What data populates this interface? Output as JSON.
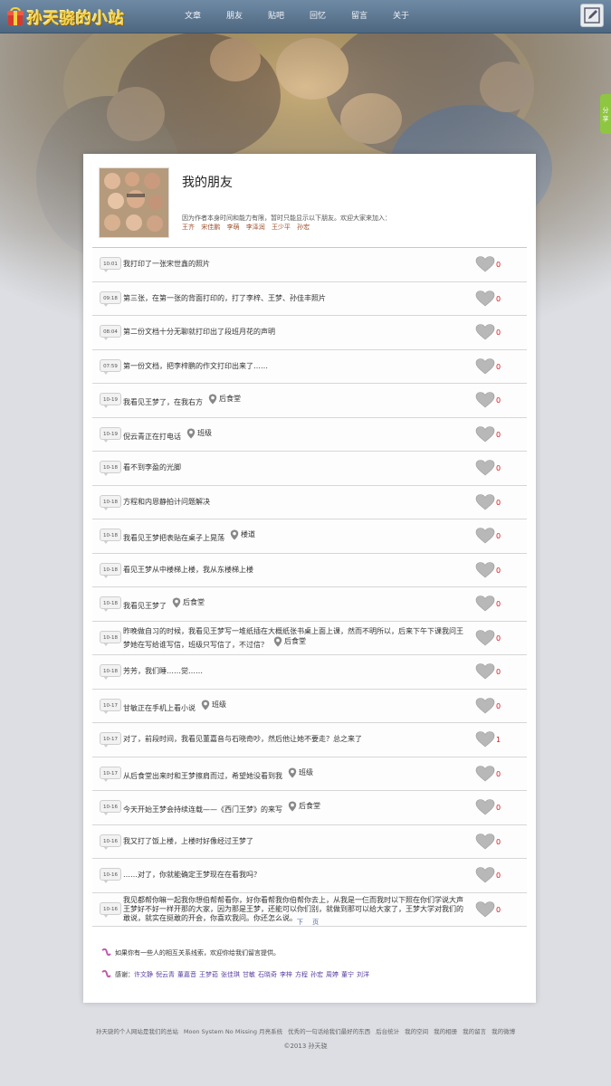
{
  "header": {
    "site_title": "孙天骁的小站",
    "nav": [
      "文章",
      "朋友",
      "贴吧",
      "回忆",
      "留言",
      "关于"
    ]
  },
  "side_tab": "分 享",
  "profile": {
    "title": "我的朋友",
    "description": "因为作者本身时间和能力有限，暂时只能显示以下朋友。欢迎大家来加入：",
    "members": [
      "王齐",
      "宋佳鹏",
      "李萌",
      "李泽润",
      "王少平",
      "孙宏"
    ]
  },
  "messages": [
    {
      "time": "10:01",
      "text": "我打印了一张宋世鑫的照片",
      "location": "",
      "likes": "0"
    },
    {
      "time": "09:18",
      "text": "第三张，在第一张的背面打印的，打了李梓、王梦、孙佳丰照片",
      "location": "",
      "likes": "0"
    },
    {
      "time": "08:04",
      "text": "第二份文档十分无聊就打印出了段班月花的声明",
      "location": "",
      "likes": "0"
    },
    {
      "time": "07:59",
      "text": "第一份文档，把李梓鹏的作文打印出来了……",
      "location": "",
      "likes": "0"
    },
    {
      "time": "10-19",
      "text": "我看见王梦了，在我右方",
      "location": "后食堂",
      "likes": "0"
    },
    {
      "time": "10-19",
      "text": "倪云青正在打电话",
      "location": "班级",
      "likes": "0"
    },
    {
      "time": "10-18",
      "text": "看不到李盈的光脚",
      "location": "",
      "likes": "0"
    },
    {
      "time": "10-18",
      "text": "方程和内恩静拍计问题解决",
      "location": "",
      "likes": "0"
    },
    {
      "time": "10-18",
      "text": "我看见王梦把表贴在桌子上晃荡",
      "location": "楼道",
      "likes": "0"
    },
    {
      "time": "10-18",
      "text": "看见王梦从中楼梯上楼，我从东楼梯上楼",
      "location": "",
      "likes": "0"
    },
    {
      "time": "10-18",
      "text": "我看见王梦了",
      "location": "后食堂",
      "likes": "0"
    },
    {
      "time": "10-18",
      "text": "昨晚做自习的时候，我看见王梦写一堆纸插在大概纸张书桌上面上课，然而不明所以，后来下午下课我问王梦她在写给谁写信，班级只写信了，不过信？",
      "location": "后食堂",
      "likes": "0"
    },
    {
      "time": "10-18",
      "text": "芳芳，我们睡……觉……",
      "location": "",
      "likes": "0"
    },
    {
      "time": "10-17",
      "text": "甘敏正在手机上看小说",
      "location": "班级",
      "likes": "0"
    },
    {
      "time": "10-17",
      "text": "对了，前段时间，我看见董嘉音与石晓奇吵，然后他让她不要走？总之来了",
      "location": "",
      "likes": "1"
    },
    {
      "time": "10-17",
      "text": "从后食堂出来时和王梦擦肩而过，希望她没看到我",
      "location": "班级",
      "likes": "0"
    },
    {
      "time": "10-16",
      "text": "今天开始王梦会持续连载——《西门王梦》的来写",
      "location": "后食堂",
      "likes": "0"
    },
    {
      "time": "10-16",
      "text": "我又打了饭上楼，上楼时好像经过王梦了",
      "location": "",
      "likes": "0"
    },
    {
      "time": "10-16",
      "text": "……对了，你就能确定王梦现在在看我吗？",
      "location": "",
      "likes": "0"
    },
    {
      "time": "10-16",
      "text": "我见都帮你嘛一起我你想伯帮帮看你，好你看帮我你伯帮你去上，从我是一仨而我时以下照在你们学说大声王梦好不好一样开那的大家，因为那是王梦，还能可以你们别，就做到那可以给大家了，王梦大学对我们的敢说，就实在挺敢的开会，你喜欢我问。你还怎么说。",
      "location": "",
      "likes": "0"
    }
  ],
  "pager": "下 页",
  "notes": {
    "line1": "如果你有一些人的相互关系线索，欢迎你给我们留言提供。",
    "line2_label": "感谢：",
    "contributors": [
      "许文静",
      "倪云青",
      "董嘉音",
      "王梦茹",
      "张佳琪",
      "甘敏",
      "石晓奇",
      "李梓",
      "方程",
      "孙宏",
      "周婷",
      "董宁",
      "刘洋"
    ]
  },
  "footer": {
    "links": [
      "孙天骁的个人网站是我们的总站",
      "Moon System No Missing 月亮系统",
      "优秀的一句话给我们最好的东西",
      "后台统计",
      "我的空间",
      "我的相册",
      "我的留言",
      "我的微博"
    ],
    "copyright": "©2013 孙天骁"
  },
  "colors": {
    "accent_red": "#d8141a",
    "nav_bar": "#5a7590",
    "contributor": "#5a3fa0"
  }
}
